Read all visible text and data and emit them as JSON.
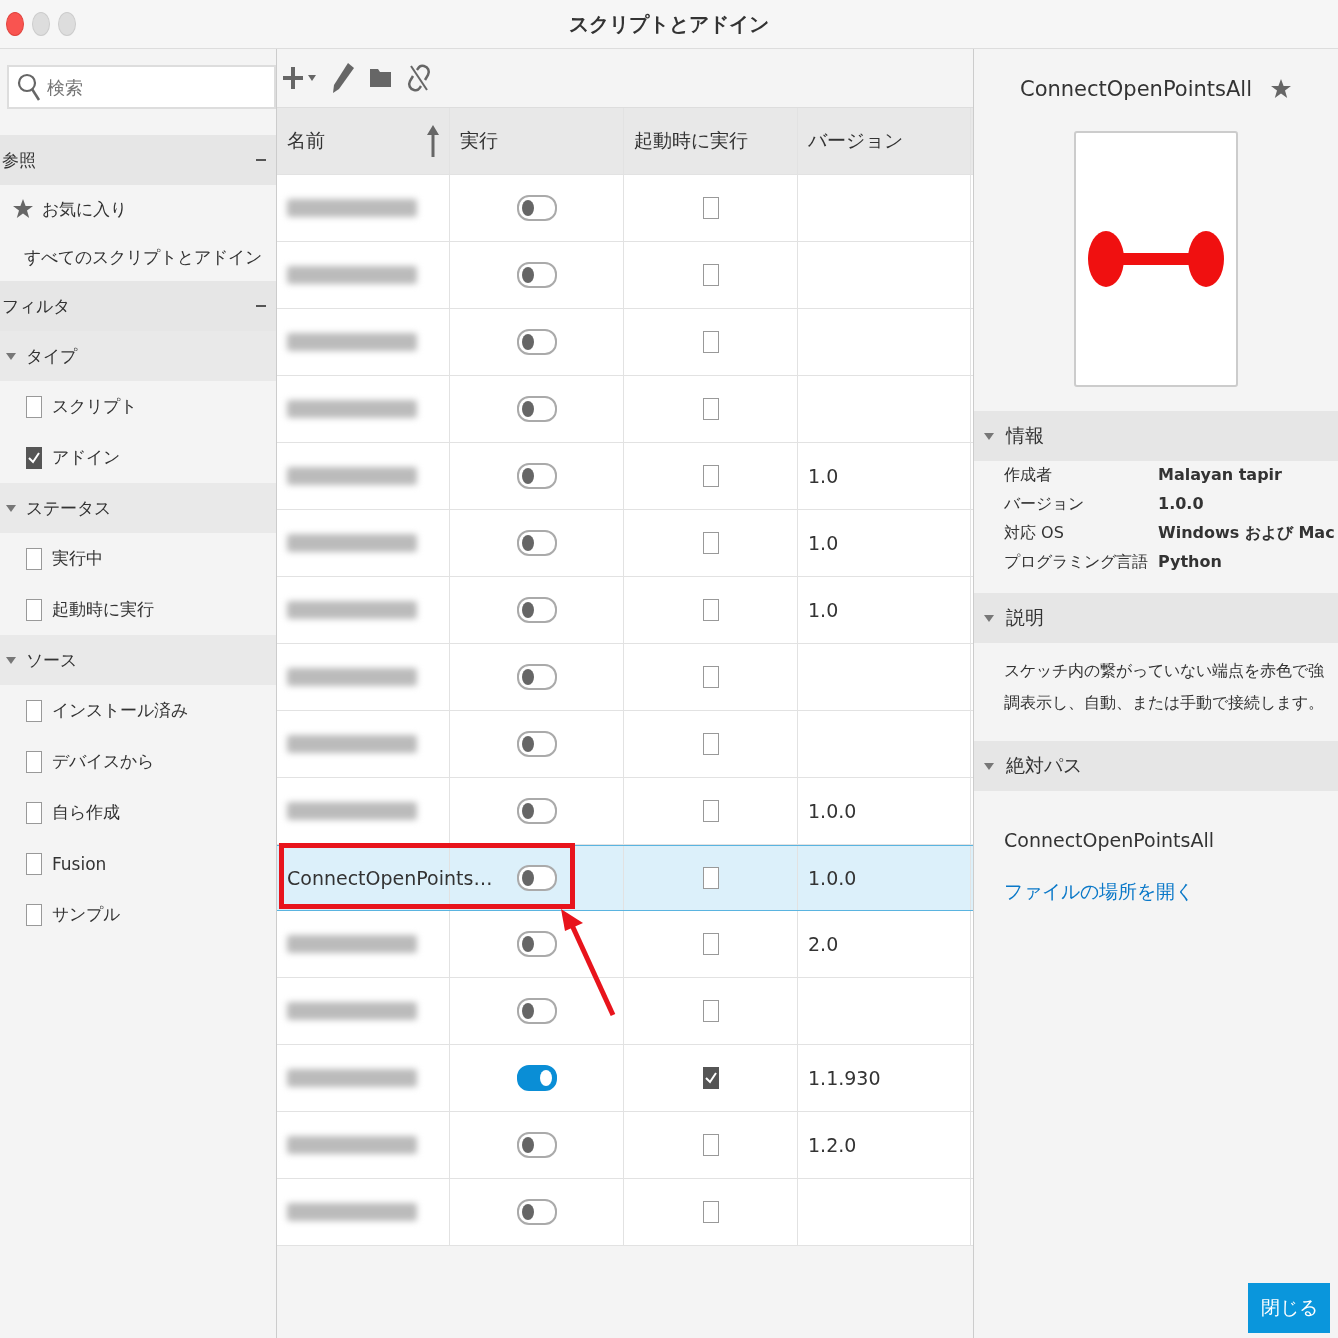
{
  "window": {
    "title": "スクリプトとアドイン"
  },
  "sidebar": {
    "search": {
      "placeholder": "検索"
    },
    "sections": [
      {
        "title": "参照",
        "expanded": true,
        "items": [
          {
            "kind": "starred",
            "label": "お気に入り"
          },
          {
            "kind": "plain",
            "label": "すべてのスクリプトとアドイン"
          }
        ]
      },
      {
        "title": "フィルタ",
        "expanded": true,
        "groups": [
          {
            "title": "タイプ",
            "expanded": true,
            "options": [
              {
                "label": "スクリプト",
                "checked": false
              },
              {
                "label": "アドイン",
                "checked": true
              }
            ]
          },
          {
            "title": "ステータス",
            "expanded": true,
            "options": [
              {
                "label": "実行中",
                "checked": false
              },
              {
                "label": "起動時に実行",
                "checked": false
              }
            ]
          },
          {
            "title": "ソース",
            "expanded": true,
            "options": [
              {
                "label": "インストール済み",
                "checked": false
              },
              {
                "label": "デバイスから",
                "checked": false
              },
              {
                "label": "自ら作成",
                "checked": false
              },
              {
                "label": "Fusion",
                "checked": false
              },
              {
                "label": "サンプル",
                "checked": false
              }
            ]
          }
        ]
      }
    ]
  },
  "table": {
    "columns": [
      {
        "label": "名前",
        "sorted": true
      },
      {
        "label": "実行",
        "sorted": false
      },
      {
        "label": "起動時に実行",
        "sorted": false
      },
      {
        "label": "バージョン",
        "sorted": false
      }
    ],
    "rows": [
      {
        "kind": "blurred",
        "running": false,
        "startup": false,
        "selected": false
      },
      {
        "kind": "blurred",
        "running": false,
        "startup": false,
        "selected": false
      },
      {
        "kind": "blurred",
        "running": false,
        "startup": false,
        "selected": false
      },
      {
        "kind": "blurred",
        "running": false,
        "startup": false,
        "selected": false
      },
      {
        "kind": "blurred",
        "running": false,
        "startup": false,
        "version": "1.0",
        "selected": false
      },
      {
        "kind": "blurred",
        "running": false,
        "startup": false,
        "version": "1.0",
        "selected": false
      },
      {
        "kind": "blurred",
        "running": false,
        "startup": false,
        "version": "1.0",
        "selected": false
      },
      {
        "kind": "blurred",
        "running": false,
        "startup": false,
        "selected": false
      },
      {
        "kind": "blurred",
        "running": false,
        "startup": false,
        "selected": false
      },
      {
        "kind": "blurred",
        "running": false,
        "startup": false,
        "version": "1.0.0",
        "selected": false
      },
      {
        "kind": "text",
        "name": "ConnectOpenPoints…",
        "running": false,
        "startup": false,
        "version": "1.0.0",
        "selected": true
      },
      {
        "kind": "blurred",
        "running": false,
        "startup": false,
        "version": "2.0",
        "selected": false
      },
      {
        "kind": "blurred",
        "running": false,
        "startup": false,
        "selected": false
      },
      {
        "kind": "blurred",
        "running": true,
        "startup": true,
        "version": "1.1.930",
        "selected": false
      },
      {
        "kind": "blurred",
        "running": false,
        "startup": false,
        "version": "1.2.0",
        "selected": false
      },
      {
        "kind": "blurred",
        "running": false,
        "startup": false,
        "selected": false
      }
    ]
  },
  "annotation": {
    "frame": true,
    "arrow": true
  },
  "details": {
    "title": "ConnectOpenPointsAll",
    "favorite": false,
    "sections": [
      {
        "kind": "info",
        "title": "情報",
        "expanded": true,
        "rows": [
          {
            "label": "作成者",
            "value": "Malayan tapir"
          },
          {
            "label": "バージョン",
            "value": "1.0.0"
          },
          {
            "label": "対応 OS",
            "value": "Windows および Mac"
          },
          {
            "label": "プログラミング言語",
            "value": "Python"
          }
        ]
      },
      {
        "kind": "text",
        "title": "説明",
        "expanded": true,
        "text": "スケッチ内の繋がっていない端点を赤色で強調表示し、自動、または手動で接続します。"
      },
      {
        "kind": "path",
        "title": "絶対パス",
        "expanded": true,
        "path": "ConnectOpenPointsAll",
        "link": "ファイルの場所を開く"
      }
    ]
  },
  "buttons": [
    {
      "label": "閉じる"
    }
  ]
}
